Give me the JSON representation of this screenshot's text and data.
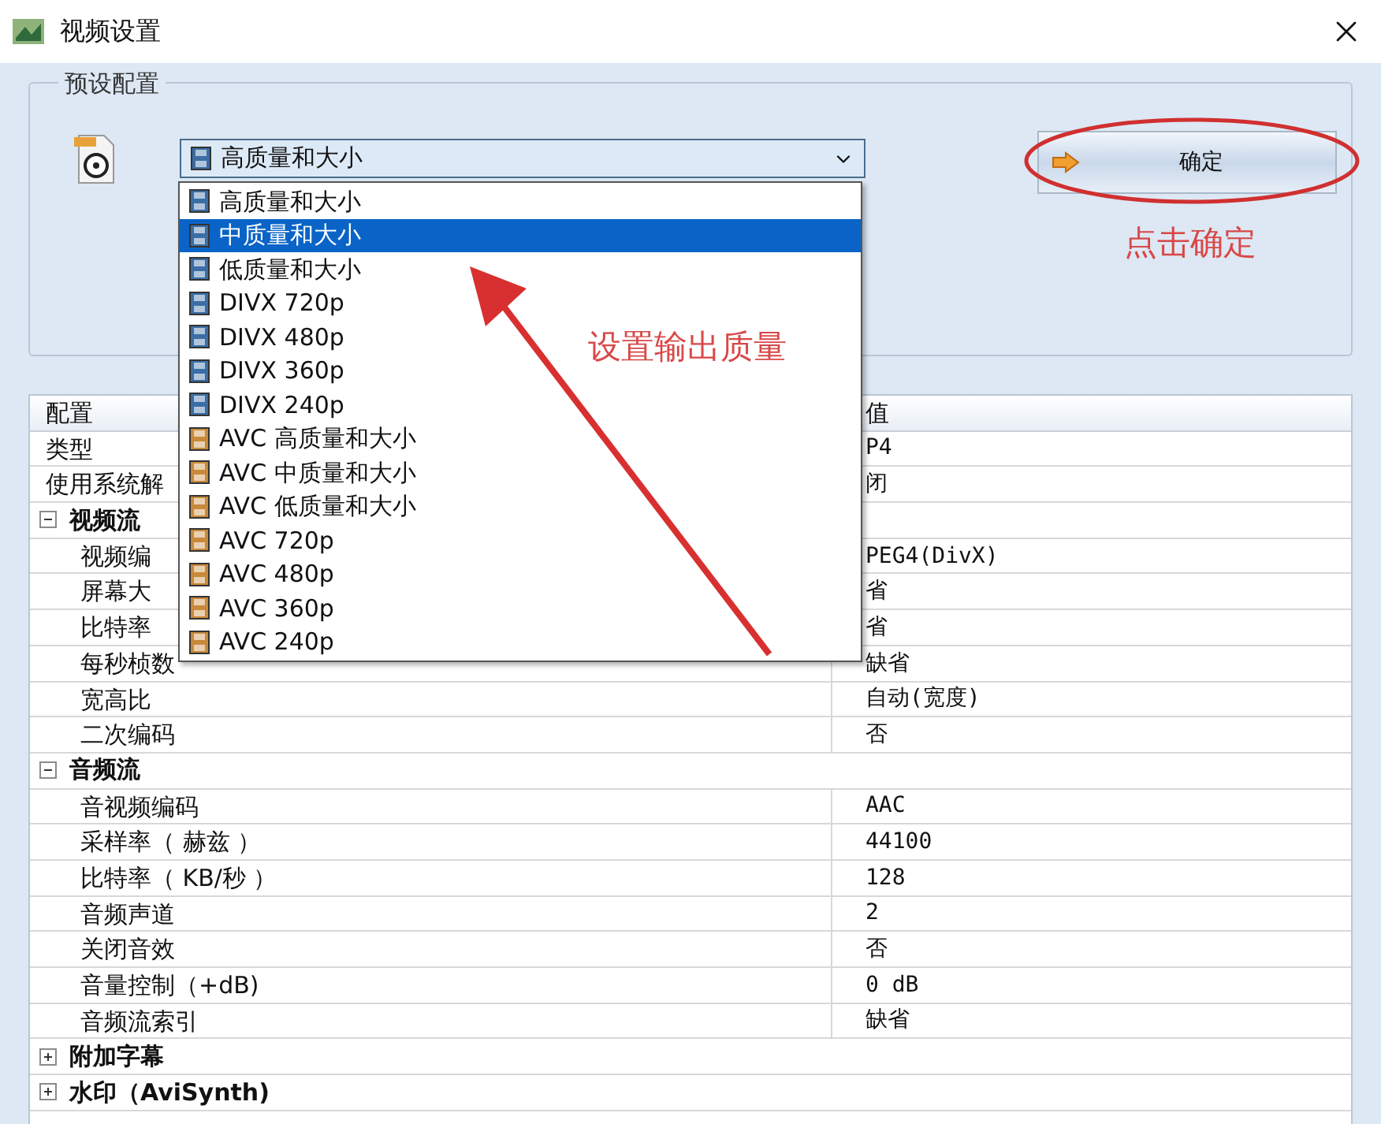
{
  "window": {
    "title": "视频设置"
  },
  "preset_group": {
    "legend": "预设配置",
    "combo": {
      "value": "高质量和大小",
      "color": "#3a6ea5"
    },
    "dropdown": [
      {
        "label": "高质量和大小",
        "color": "#3a6ea5",
        "selected": false
      },
      {
        "label": "中质量和大小",
        "color": "#3a6ea5",
        "selected": true
      },
      {
        "label": "低质量和大小",
        "color": "#3a6ea5",
        "selected": false
      },
      {
        "label": "DIVX 720p",
        "color": "#3a6ea5",
        "selected": false
      },
      {
        "label": "DIVX 480p",
        "color": "#3a6ea5",
        "selected": false
      },
      {
        "label": "DIVX 360p",
        "color": "#3a6ea5",
        "selected": false
      },
      {
        "label": "DIVX 240p",
        "color": "#3a6ea5",
        "selected": false
      },
      {
        "label": "AVC 高质量和大小",
        "color": "#c8893a",
        "selected": false
      },
      {
        "label": "AVC 中质量和大小",
        "color": "#c8893a",
        "selected": false
      },
      {
        "label": "AVC 低质量和大小",
        "color": "#c8893a",
        "selected": false
      },
      {
        "label": "AVC 720p",
        "color": "#c8893a",
        "selected": false
      },
      {
        "label": "AVC 480p",
        "color": "#c8893a",
        "selected": false
      },
      {
        "label": "AVC 360p",
        "color": "#c8893a",
        "selected": false
      },
      {
        "label": "AVC 240p",
        "color": "#c8893a",
        "selected": false
      }
    ],
    "ok_button": "确定"
  },
  "annotations": [
    {
      "text": "点击确定"
    },
    {
      "text": "设置输出质量"
    }
  ],
  "table": {
    "columns": [
      "配置",
      "值"
    ],
    "rows": [
      {
        "kind": "property",
        "label": "类型",
        "value": "P4"
      },
      {
        "kind": "property",
        "label": "使用系统解",
        "value": "闭"
      },
      {
        "kind": "category",
        "label": "视频流",
        "expanded": true,
        "children": [
          {
            "kind": "property",
            "label": "视频编",
            "value": "PEG4(DivX)"
          },
          {
            "kind": "property",
            "label": "屏幕大",
            "value": "省"
          },
          {
            "kind": "property",
            "label": "比特率",
            "value": "省"
          },
          {
            "kind": "property",
            "label": "每秒桢数",
            "value": "缺省"
          },
          {
            "kind": "property",
            "label": "宽高比",
            "value": "自动(宽度)"
          },
          {
            "kind": "property",
            "label": "二次编码",
            "value": "否"
          }
        ]
      },
      {
        "kind": "category",
        "label": "音频流",
        "expanded": true,
        "children": [
          {
            "kind": "property",
            "label": "音视频编码",
            "value": "AAC"
          },
          {
            "kind": "property",
            "label": "采样率（ 赫兹 ）",
            "value": "44100"
          },
          {
            "kind": "property",
            "label": "比特率（ KB/秒 ）",
            "value": "128"
          },
          {
            "kind": "property",
            "label": "音频声道",
            "value": "2"
          },
          {
            "kind": "property",
            "label": "关闭音效",
            "value": "否"
          },
          {
            "kind": "property",
            "label": "音量控制（+dB)",
            "value": "0 dB"
          },
          {
            "kind": "property",
            "label": "音频流索引",
            "value": "缺省"
          }
        ]
      },
      {
        "kind": "category",
        "label": "附加字幕",
        "expanded": false
      },
      {
        "kind": "category",
        "label": "水印（AviSynth)",
        "expanded": false
      }
    ]
  }
}
